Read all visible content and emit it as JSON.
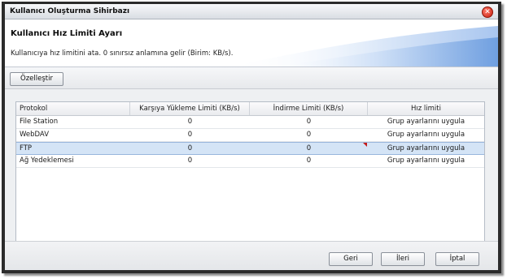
{
  "window": {
    "title": "Kullanıcı Oluşturma Sihirbazı",
    "close_icon": "close-icon"
  },
  "header": {
    "step_title": "Kullanıcı Hız Limiti Ayarı",
    "description": "Kullanıcıya hız limitini ata. 0 sınırsız anlamına gelir (Birim: KB/s)."
  },
  "toolbar": {
    "customize_label": "Özelleştir"
  },
  "table": {
    "columns": [
      "Protokol",
      "Karşıya Yükleme Limiti (KB/s)",
      "İndirme Limiti (KB/s)",
      "Hız limiti"
    ],
    "rows": [
      {
        "protocol": "File Station",
        "upload": "0",
        "download": "0",
        "limit": "Grup ayarlarını uygula"
      },
      {
        "protocol": "WebDAV",
        "upload": "0",
        "download": "0",
        "limit": "Grup ayarlarını uygula"
      },
      {
        "protocol": "FTP",
        "upload": "0",
        "download": "0",
        "limit": "Grup ayarlarını uygula"
      },
      {
        "protocol": "Ağ Yedeklemesi",
        "upload": "0",
        "download": "0",
        "limit": "Grup ayarlarını uygula"
      }
    ],
    "selected_row": 2
  },
  "footer": {
    "back_label": "Geri",
    "next_label": "İleri",
    "cancel_label": "İptal"
  },
  "colors": {
    "accent": "#6f9fe0",
    "selection": "#d4e4f6",
    "close": "#c81e0e"
  }
}
